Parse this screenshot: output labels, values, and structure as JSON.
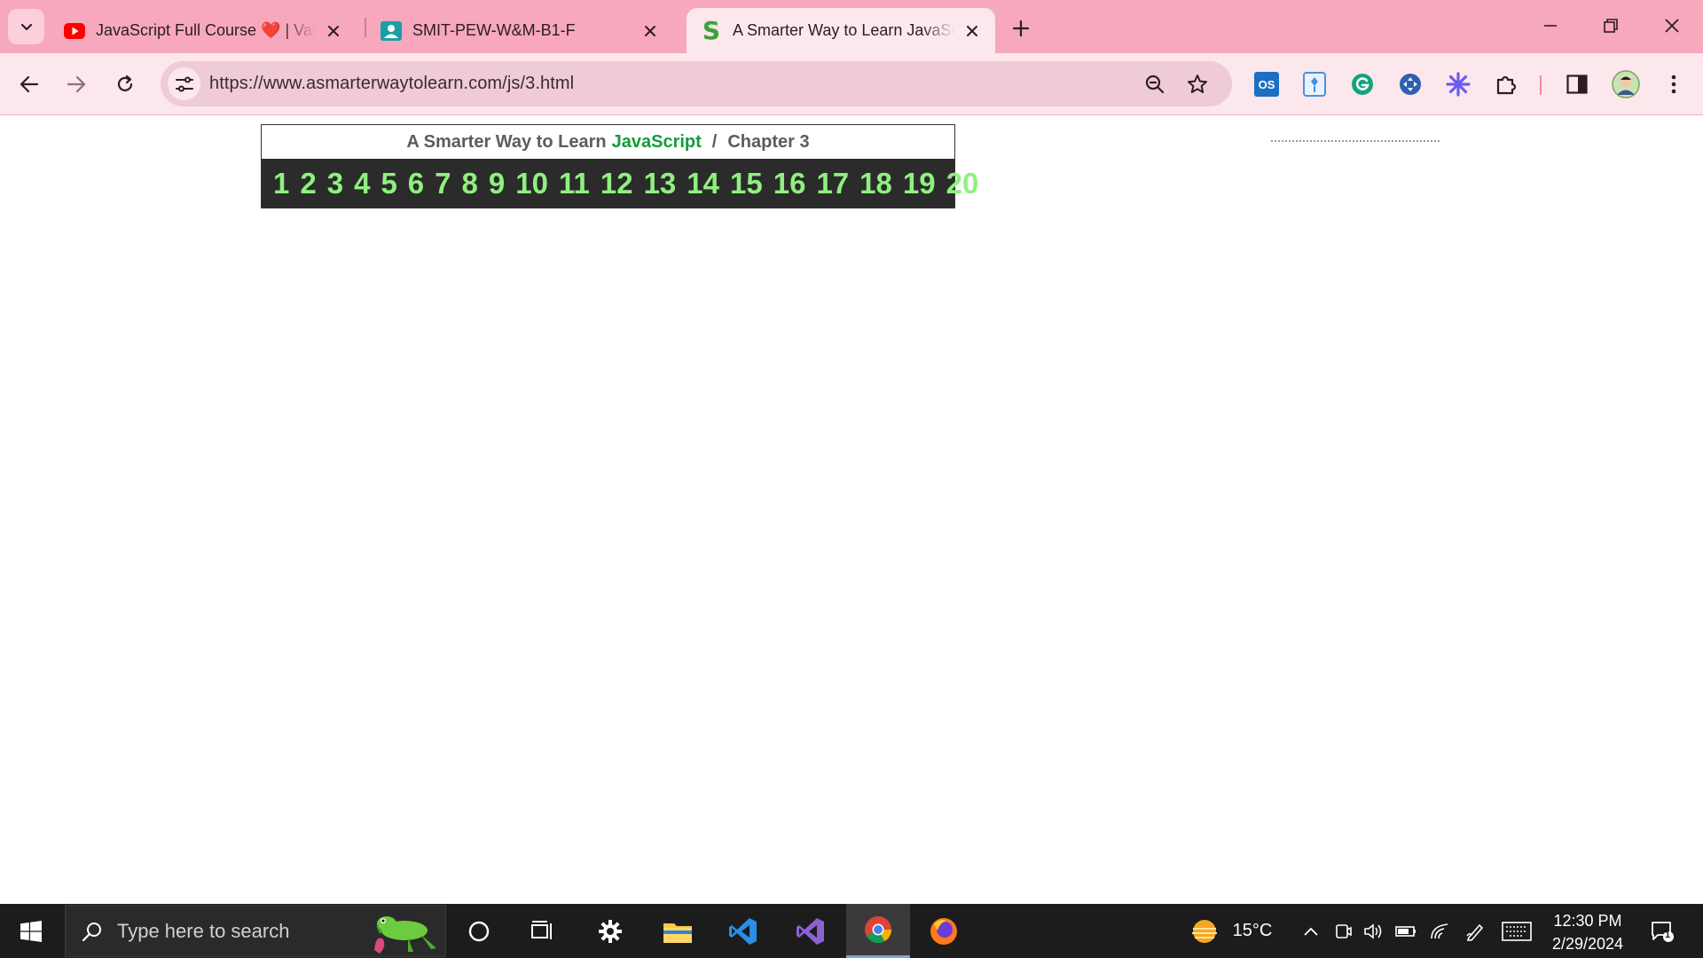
{
  "browser": {
    "tabs": [
      {
        "title": "JavaScript Full Course ❤️ | Varia",
        "favicon": "youtube-icon"
      },
      {
        "title": "SMIT-PEW-W&M-B1-F",
        "favicon": "classroom-icon"
      },
      {
        "title": "A Smarter Way to Learn JavaScr",
        "favicon": "smarter-way-s-icon",
        "active": true
      }
    ],
    "favicon_letter": "S",
    "url": "https://www.asmarterwaytolearn.com/js/3.html",
    "extensions": [
      "os-addon-icon",
      "pin-extension-icon",
      "grammarly-icon",
      "move-extension-icon",
      "asterisk-extension-icon",
      "puzzle-extensions-icon"
    ],
    "ext_label": "OS"
  },
  "page": {
    "header": {
      "prefix": "A Smarter Way to Learn",
      "highlight": "JavaScript",
      "separator": "/",
      "chapter": "Chapter 3"
    },
    "chapters": [
      "1",
      "2",
      "3",
      "4",
      "5",
      "6",
      "7",
      "8",
      "9",
      "10",
      "11",
      "12",
      "13",
      "14",
      "15",
      "16",
      "17",
      "18",
      "19",
      "20"
    ]
  },
  "taskbar": {
    "search_placeholder": "Type here to search",
    "weather": "15°C",
    "time": "12:30 PM",
    "date": "2/29/2024",
    "notifications": "1"
  },
  "colors": {
    "tabstrip": "#f7a8bc",
    "toolbar": "#fbe7ec",
    "chapter_link": "#8ff07f",
    "javascript_green": "#169b3b"
  }
}
